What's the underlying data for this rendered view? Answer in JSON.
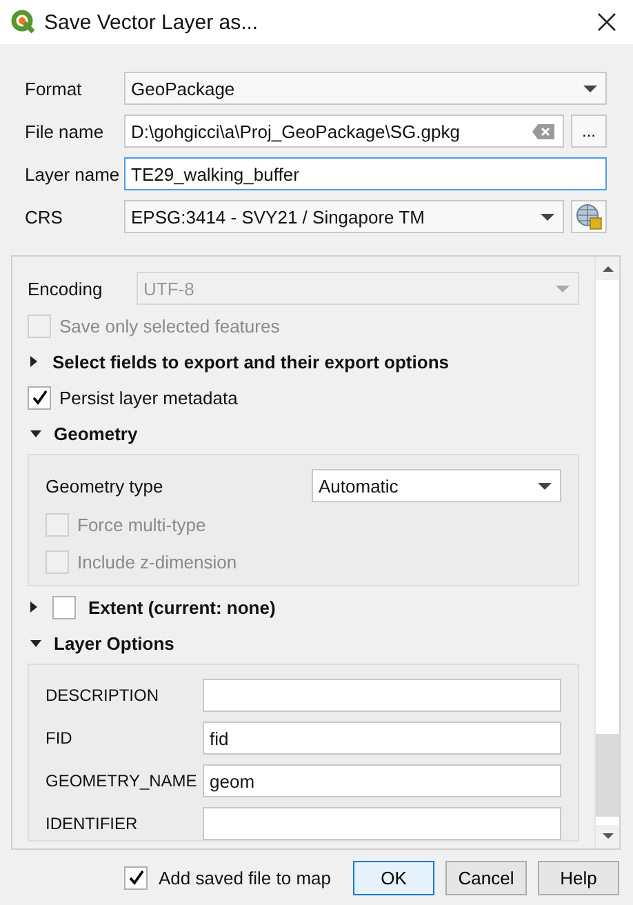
{
  "window": {
    "title": "Save Vector Layer as..."
  },
  "form": [
    {
      "kind": "combo",
      "label": "Format",
      "value": "GeoPackage"
    },
    {
      "kind": "file",
      "label": "File name",
      "value": "D:\\gohgicci\\a\\Proj_GeoPackage\\SG.gpkg",
      "browse": "..."
    },
    {
      "kind": "text",
      "label": "Layer name",
      "value": "TE29_walking_buffer",
      "focused": true
    },
    {
      "kind": "crs",
      "label": "CRS",
      "value": "EPSG:3414 - SVY21 / Singapore TM"
    }
  ],
  "options": {
    "encoding": {
      "label": "Encoding",
      "value": "UTF-8",
      "disabled": true
    },
    "save_selected": {
      "label": "Save only selected features",
      "checked": false,
      "disabled": true
    },
    "select_fields": {
      "label": "Select fields to export and their export options",
      "expanded": false
    },
    "persist_metadata": {
      "label": "Persist layer metadata",
      "checked": true
    },
    "geometry": {
      "label": "Geometry",
      "expanded": true,
      "type_label": "Geometry type",
      "type_value": "Automatic",
      "checks": [
        {
          "label": "Force multi-type",
          "checked": false,
          "disabled": true
        },
        {
          "label": "Include z-dimension",
          "checked": false,
          "disabled": true
        }
      ]
    },
    "extent": {
      "label": "Extent (current: none)",
      "expanded": false,
      "checked": false
    },
    "layer_options": {
      "label": "Layer Options",
      "expanded": true,
      "fields": [
        {
          "label": "DESCRIPTION"
        },
        {
          "label": "FID",
          "value": "fid"
        },
        {
          "label": "GEOMETRY_NAME",
          "value": "geom"
        },
        {
          "label": "IDENTIFIER"
        }
      ]
    }
  },
  "footer": {
    "add_to_map": {
      "label": "Add saved file to map",
      "checked": true
    },
    "buttons": [
      {
        "label": "OK",
        "default": true
      },
      {
        "label": "Cancel",
        "default": false
      },
      {
        "label": "Help",
        "default": false
      }
    ]
  }
}
